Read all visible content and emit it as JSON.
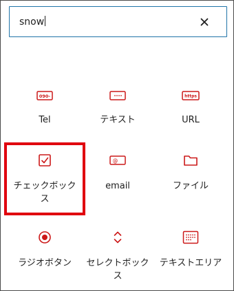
{
  "search": {
    "value": "snow",
    "clear_icon": "close-icon"
  },
  "accent_color": "#cc1818",
  "highlight_color": "#e0000e",
  "blocks": [
    {
      "label": "Tel",
      "icon": "tel-field-icon",
      "icon_text": "090-"
    },
    {
      "label": "テキスト",
      "icon": "text-field-icon"
    },
    {
      "label": "URL",
      "icon": "url-field-icon",
      "icon_text": "https"
    },
    {
      "label": "チェックボックス",
      "icon": "checkbox-icon"
    },
    {
      "label": "email",
      "icon": "email-field-icon",
      "icon_text": "@"
    },
    {
      "label": "ファイル",
      "icon": "folder-icon"
    },
    {
      "label": "ラジオボタン",
      "icon": "radio-button-icon"
    },
    {
      "label": "セレクトボックス",
      "icon": "select-chevrons-icon"
    },
    {
      "label": "テキストエリア",
      "icon": "textarea-icon"
    }
  ]
}
